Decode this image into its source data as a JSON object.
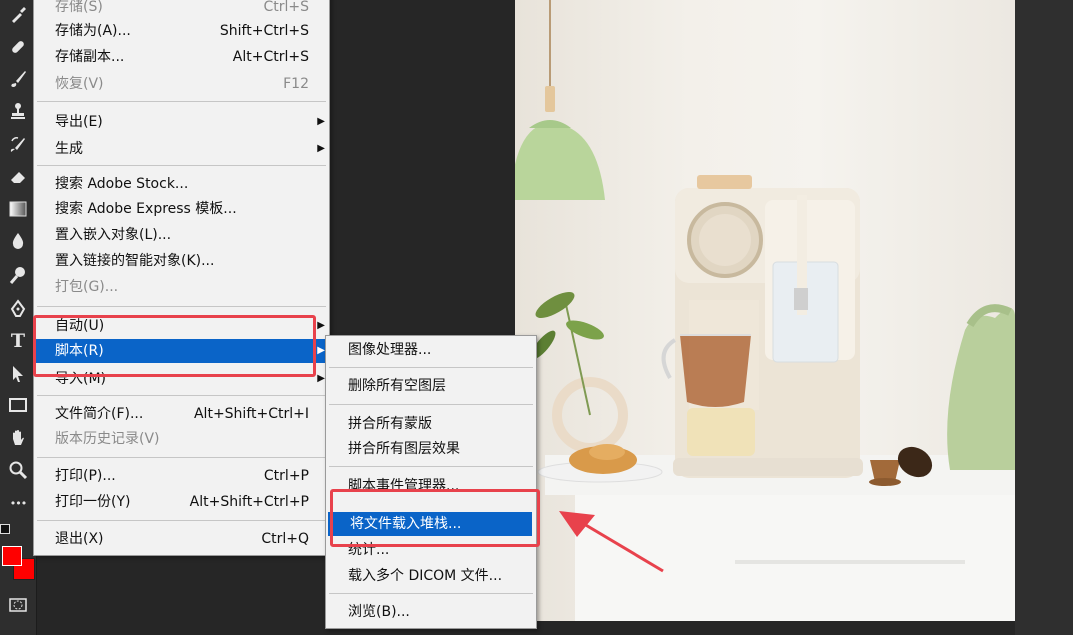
{
  "file_menu": {
    "items": [
      {
        "label": "存储(S)",
        "shortcut": "Ctrl+S",
        "disabled": true
      },
      {
        "label": "存储为(A)...",
        "shortcut": "Shift+Ctrl+S"
      },
      {
        "label": "存储副本...",
        "shortcut": "Alt+Ctrl+S"
      },
      {
        "label": "恢复(V)",
        "shortcut": "F12",
        "disabled": true
      },
      {
        "label": "导出(E)",
        "submenu": true
      },
      {
        "label": "生成",
        "submenu": true
      },
      {
        "label": "搜索 Adobe Stock..."
      },
      {
        "label": "搜索 Adobe Express 模板..."
      },
      {
        "label": "置入嵌入对象(L)..."
      },
      {
        "label": "置入链接的智能对象(K)..."
      },
      {
        "label": "打包(G)...",
        "disabled": true
      },
      {
        "label": "自动(U)",
        "submenu": true
      },
      {
        "label": "脚本(R)",
        "submenu": true,
        "highlighted": true
      },
      {
        "label": "导入(M)",
        "submenu": true
      },
      {
        "label": "文件简介(F)...",
        "shortcut": "Alt+Shift+Ctrl+I"
      },
      {
        "label": "版本历史记录(V)",
        "disabled": true
      },
      {
        "label": "打印(P)...",
        "shortcut": "Ctrl+P"
      },
      {
        "label": "打印一份(Y)",
        "shortcut": "Alt+Shift+Ctrl+P"
      },
      {
        "label": "退出(X)",
        "shortcut": "Ctrl+Q"
      }
    ]
  },
  "scripts_submenu": {
    "items": [
      {
        "label": "图像处理器..."
      },
      {
        "label": "删除所有空图层"
      },
      {
        "label": "拼合所有蒙版"
      },
      {
        "label": "拼合所有图层效果"
      },
      {
        "label": "脚本事件管理器..."
      },
      {
        "label": "将文件载入堆栈...",
        "highlighted": true
      },
      {
        "label": "统计..."
      },
      {
        "label": "载入多个 DICOM 文件..."
      },
      {
        "label": "浏览(B)..."
      }
    ]
  },
  "toolbar": {
    "type_tool_glyph": "T",
    "more_glyph": "•••",
    "foreground_color": "#ff0000",
    "background_color": "#ff0000"
  },
  "colors": {
    "highlight": "#0a64c8",
    "annotation": "#e8424c"
  }
}
